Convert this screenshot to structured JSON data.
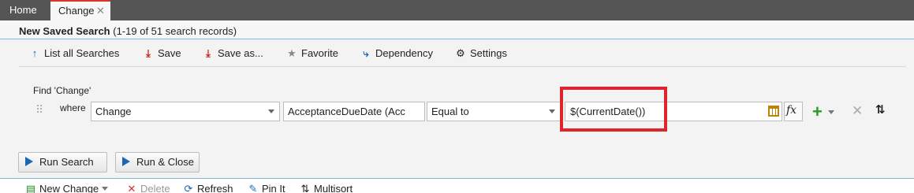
{
  "tabs": {
    "home": "Home",
    "change": "Change",
    "close_glyph": "✕"
  },
  "header": {
    "title": "New Saved Search",
    "count": "(1-19 of 51 search records)"
  },
  "toolbar": {
    "list_all": "List all Searches",
    "save": "Save",
    "save_as": "Save as...",
    "favorite": "Favorite",
    "dependency": "Dependency",
    "settings": "Settings"
  },
  "criteria": {
    "find_label": "Find 'Change'",
    "where_label": "where",
    "entity": "Change",
    "field": "AcceptanceDueDate (Acc",
    "operator": "Equal to",
    "value": "$(CurrentDate())"
  },
  "buttons": {
    "run_search": "Run Search",
    "run_close": "Run & Close"
  },
  "bottom_toolbar": {
    "new_change": "New Change",
    "delete": "Delete",
    "refresh": "Refresh",
    "pin_it": "Pin It",
    "multisort": "Multisort"
  },
  "colors": {
    "tab_bar": "#555555",
    "accent_blue": "#1a66b3",
    "highlight_red": "#e0242b",
    "add_green": "#2a9a2a"
  }
}
